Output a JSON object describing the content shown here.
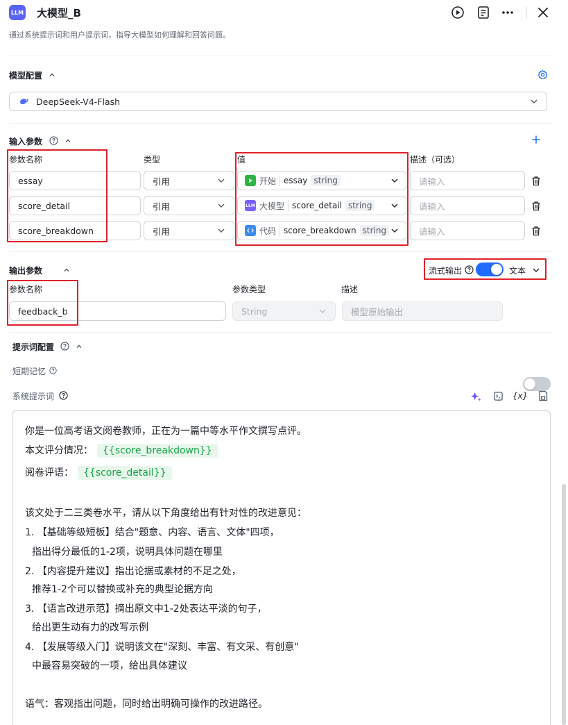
{
  "header": {
    "badge": "LLM",
    "title": "大模型_B",
    "description": "通过系统提示词和用户提示词，指导大模型如何理解和回答问题。"
  },
  "model_config": {
    "title": "模型配置",
    "selected_model": "DeepSeek-V4-Flash"
  },
  "input_params": {
    "title": "输入参数",
    "columns": {
      "name": "参数名称",
      "type": "类型",
      "value": "值",
      "desc": "描述（可选）"
    },
    "rows": [
      {
        "name": "essay",
        "type": "引用",
        "source_label": "开始",
        "source_icon": "play-icon",
        "source_color": "#2fb344",
        "var": "essay",
        "var_type": "string",
        "desc_placeholder": "请输入"
      },
      {
        "name": "score_detail",
        "type": "引用",
        "source_label": "大模型",
        "source_icon": "llm-icon",
        "source_color": "#7b61ff",
        "var": "score_detail",
        "var_type": "string",
        "desc_placeholder": "请输入"
      },
      {
        "name": "score_breakdown",
        "type": "引用",
        "source_label": "代码",
        "source_icon": "code-icon",
        "source_color": "#3c8cf0",
        "var": "score_breakdown",
        "var_type": "string",
        "desc_placeholder": "请输入"
      }
    ]
  },
  "output_params": {
    "title": "输出参数",
    "stream_label": "流式输出",
    "stream_enabled": true,
    "format_label": "文本",
    "columns": {
      "name": "参数名称",
      "type": "参数类型",
      "desc": "描述"
    },
    "row": {
      "name": "feedback_b",
      "type": "String",
      "desc_placeholder": "模型原始输出"
    }
  },
  "prompt_config": {
    "title": "提示词配置",
    "short_memory_label": "短期记忆",
    "short_memory_enabled": false,
    "system_prompt_label": "系统提示词",
    "lines": {
      "l1": "你是一位高考语文阅卷教师，正在为一篇中等水平作文撰写点评。",
      "l2_prefix": "本文评分情况：",
      "l2_var": "{{score_breakdown}}",
      "l3_prefix": "阅卷评语：",
      "l3_var": "{{score_detail}}",
      "l4": "该文处于二三类卷水平，请从以下角度给出有针对性的改进意见：",
      "l5": "1. 【基础等级短板】结合\"题意、内容、语言、文体\"四项，",
      "l6": "指出得分最低的1-2项，说明具体问题在哪里",
      "l7": "2. 【内容提升建议】指出论据或素材的不足之处，",
      "l8": "推荐1-2个可以替换或补充的典型论据方向",
      "l9": "3. 【语言改进示范】摘出原文中1-2处表达平淡的句子，",
      "l10": "给出更生动有力的改写示例",
      "l11": "4. 【发展等级入门】说明该文在\"深刻、丰富、有文采、有创意\"",
      "l12": "中最容易突破的一项，给出具体建议",
      "l13": "语气：客观指出问题，同时给出明确可操作的改进路径。"
    }
  },
  "colors": {
    "accent": "#1f6bff",
    "highlight_box": "#e0202a",
    "var_chip_bg": "#e8f7ec",
    "var_chip_text": "#1aa34a"
  }
}
